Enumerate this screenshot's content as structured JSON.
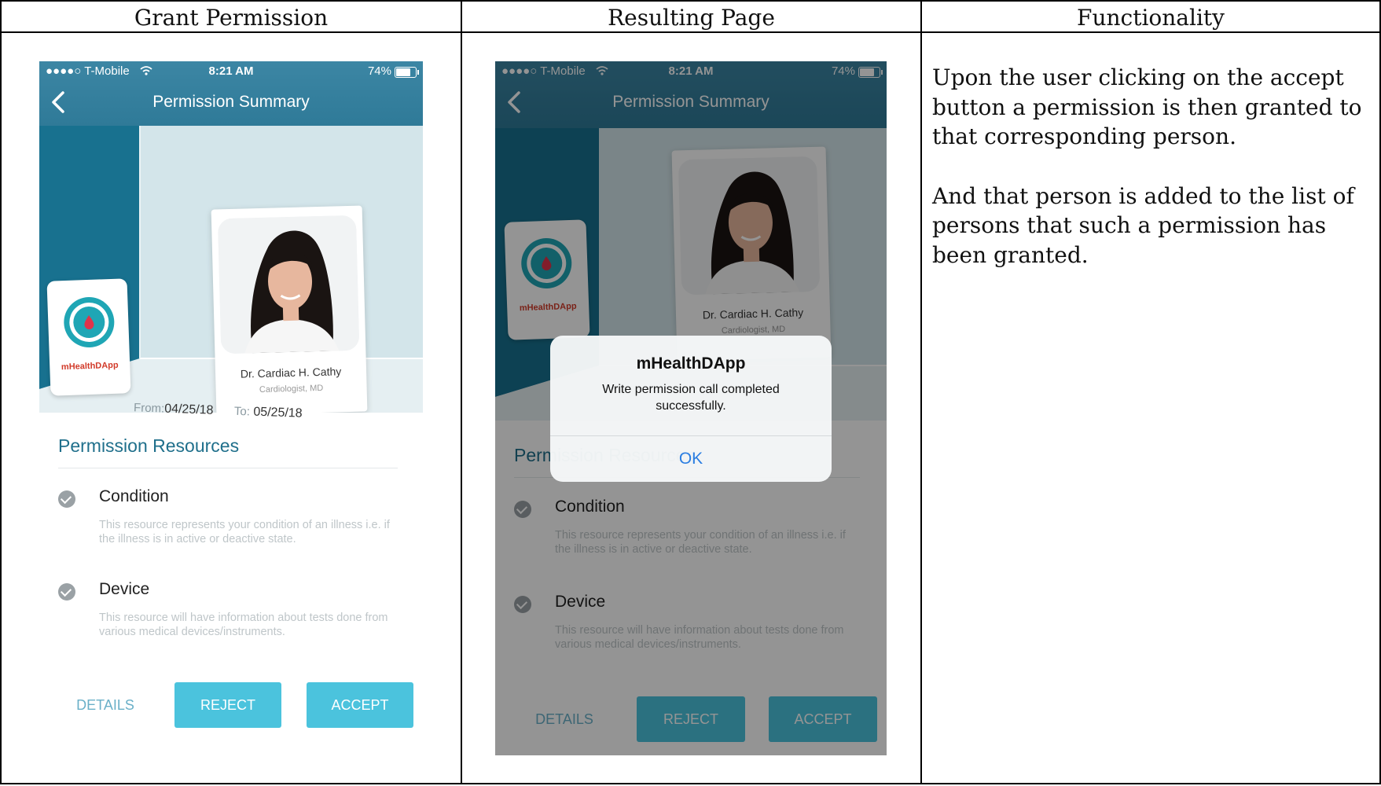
{
  "table": {
    "headers": [
      "Grant Permission",
      "Resulting Page",
      "Functionality"
    ]
  },
  "functionality": {
    "paragraphs": [
      "Upon the user clicking on the accept button a permission is then granted to that corresponding person.",
      "And that person is added to the list of persons that such a permission has been granted."
    ]
  },
  "status_bar": {
    "carrier": "●●●●○ T-Mobile",
    "time": "8:21 AM",
    "battery": "74%"
  },
  "nav": {
    "title": "Permission Summary"
  },
  "app_card": {
    "name": "mHealthDApp"
  },
  "doctor": {
    "name": "Dr. Cardiac H. Cathy",
    "role": "Cardiologist, MD"
  },
  "dates": {
    "from_label": "From:",
    "from": "04/25/18",
    "to_label": "To:",
    "to": "05/25/18"
  },
  "resources": {
    "title": "Permission Resources",
    "items": [
      {
        "title": "Condition",
        "desc": "This resource represents your condition of an illness i.e. if the illness is in active or deactive state."
      },
      {
        "title": "Device",
        "desc": "This resource will have information about tests done from various medical devices/instruments."
      }
    ]
  },
  "buttons": {
    "details": "DETAILS",
    "reject": "REJECT",
    "accept": "ACCEPT"
  },
  "alert": {
    "title": "mHealthDApp",
    "message": "Write permission call completed successfully.",
    "ok": "OK"
  },
  "colors": {
    "nav": "#3c86a4",
    "accent": "#4bc3dd",
    "title_blue": "#1f6f8b",
    "ios_link": "#2a7de1",
    "brand_red": "#d23b2a"
  }
}
